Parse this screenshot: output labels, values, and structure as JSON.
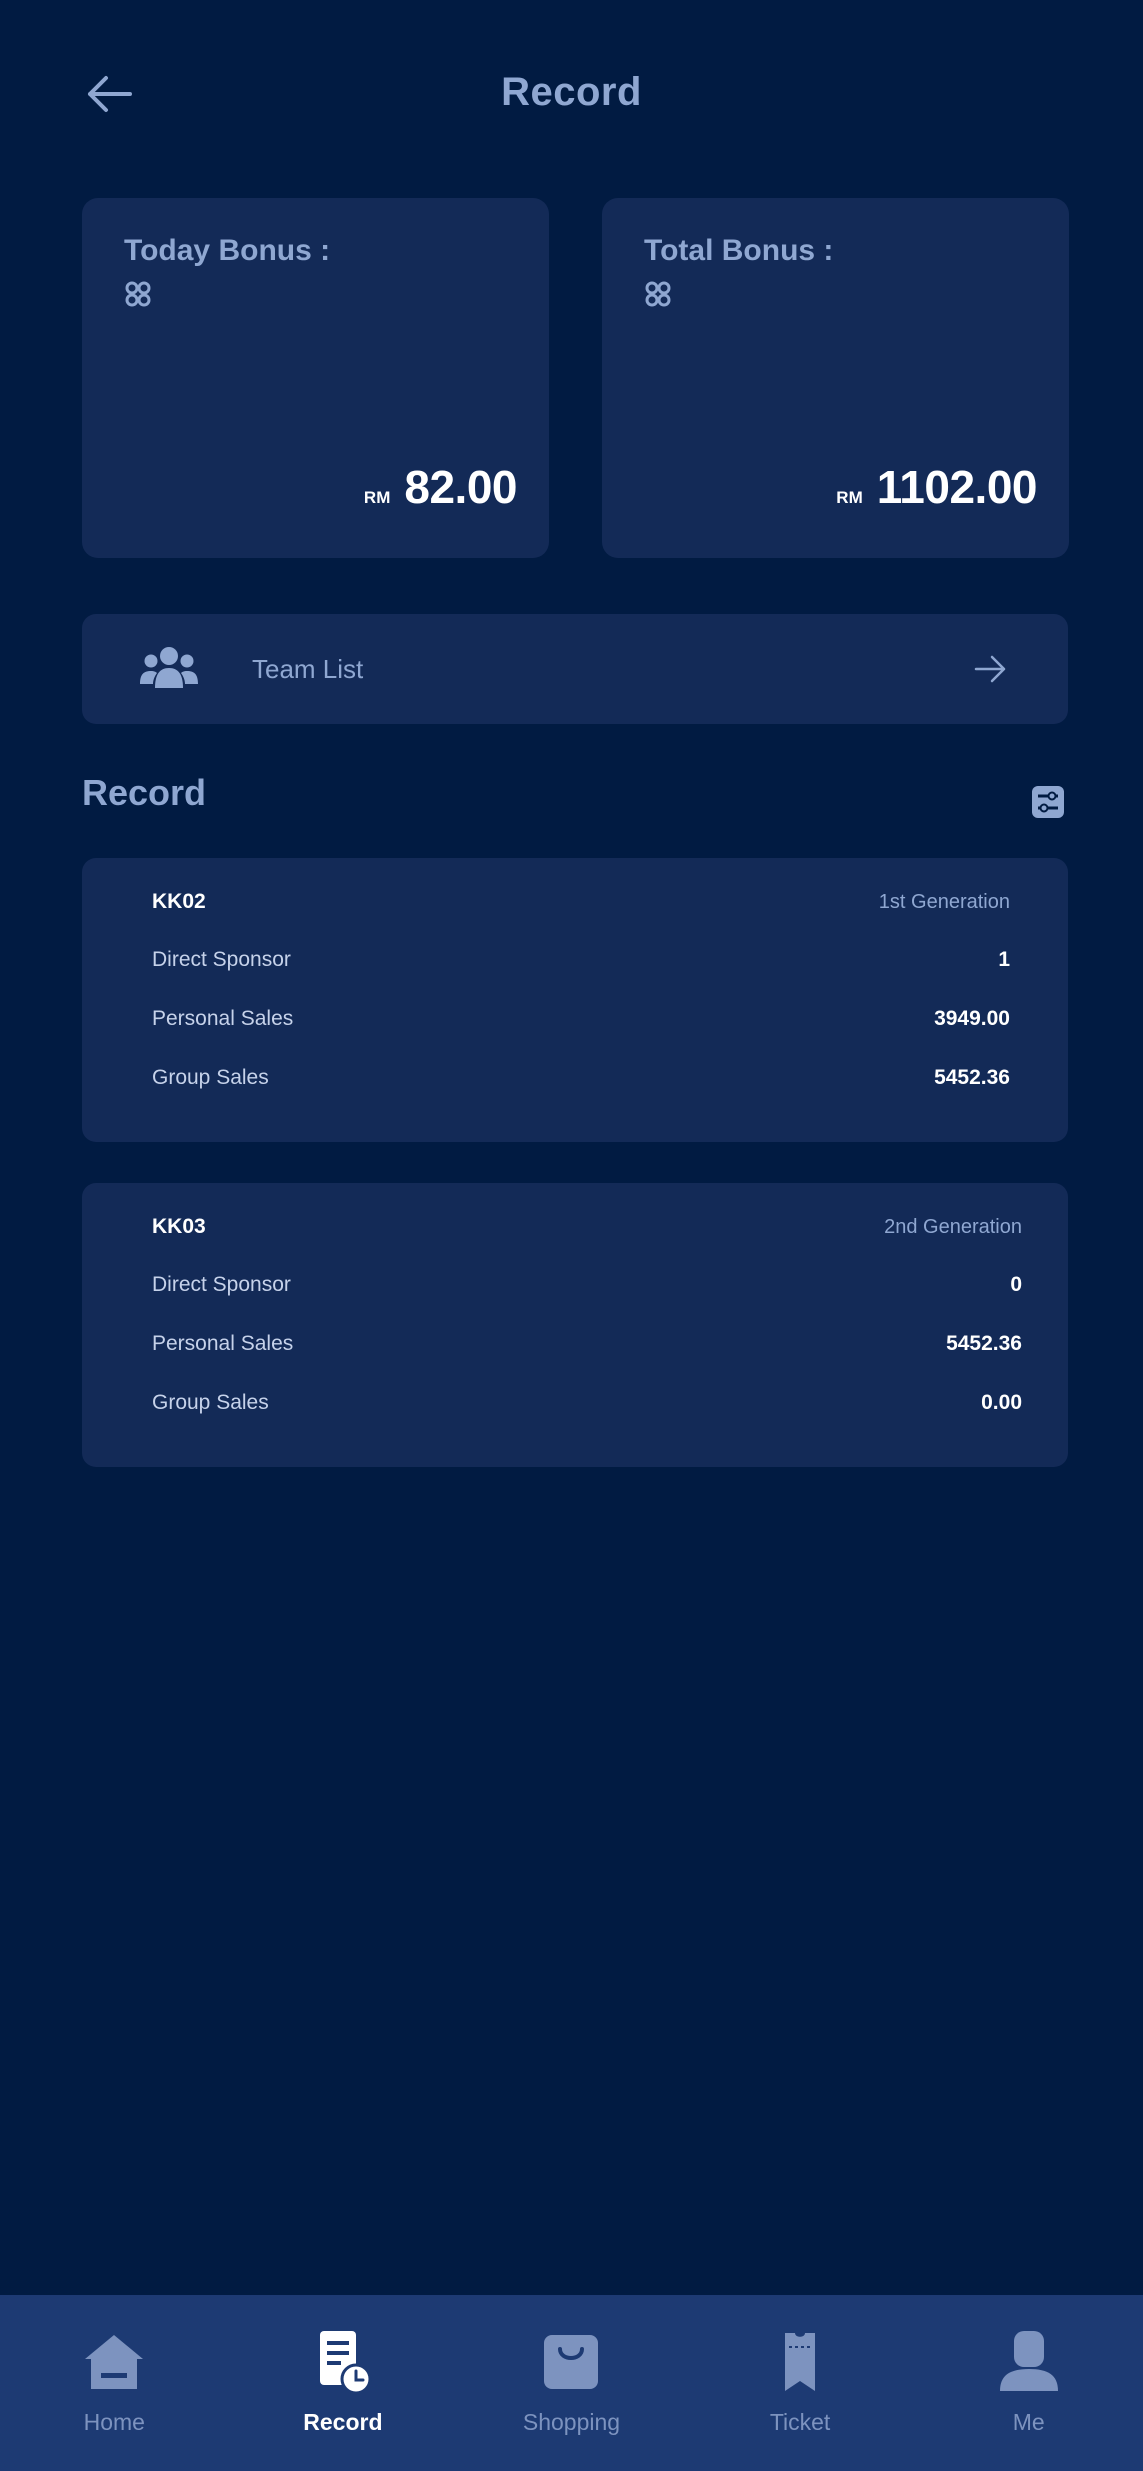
{
  "header": {
    "title": "Record"
  },
  "bonus": {
    "today": {
      "label": "Today Bonus :",
      "currency": "RM",
      "amount": "82.00"
    },
    "total": {
      "label": "Total Bonus :",
      "currency": "RM",
      "amount": "1102.00"
    }
  },
  "team_list": {
    "label": "Team List"
  },
  "record_section": {
    "title": "Record"
  },
  "records": [
    {
      "id": "KK02",
      "generation": "1st Generation",
      "rows": [
        {
          "label": "Direct Sponsor",
          "value": "1"
        },
        {
          "label": "Personal Sales",
          "value": "3949.00"
        },
        {
          "label": "Group Sales",
          "value": "5452.36"
        }
      ]
    },
    {
      "id": "KK03",
      "generation": "2nd Generation",
      "rows": [
        {
          "label": "Direct Sponsor",
          "value": "0"
        },
        {
          "label": "Personal Sales",
          "value": "5452.36"
        },
        {
          "label": "Group Sales",
          "value": "0.00"
        }
      ]
    }
  ],
  "nav": {
    "items": [
      {
        "label": "Home",
        "icon": "home-icon",
        "active": false
      },
      {
        "label": "Record",
        "icon": "record-icon",
        "active": true
      },
      {
        "label": "Shopping",
        "icon": "shopping-bag-icon",
        "active": false
      },
      {
        "label": "Ticket",
        "icon": "ticket-icon",
        "active": false
      },
      {
        "label": "Me",
        "icon": "user-icon",
        "active": false
      }
    ]
  },
  "colors": {
    "background": "#011b42",
    "card": "#132a57",
    "nav_background": "#1d3a73",
    "muted_text": "#8fa7d1",
    "active": "#ffffff"
  }
}
